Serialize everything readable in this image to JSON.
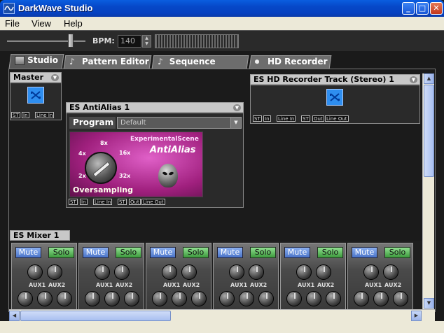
{
  "window": {
    "title": "DarkWave Studio"
  },
  "window_controls": {
    "minimize": "_",
    "maximize": "□",
    "close": "✕"
  },
  "menu": {
    "items": [
      "File",
      "View",
      "Help"
    ]
  },
  "toolbar": {
    "bpm_label": "BPM:",
    "bpm_value": "140",
    "spin_up": "▲",
    "spin_down": "▼"
  },
  "tabs": [
    {
      "label": "Studio",
      "icon": "studio-icon"
    },
    {
      "label": "Pattern Editor",
      "icon": "note-icon"
    },
    {
      "label": "Sequence Editor",
      "icon": "note-icon"
    },
    {
      "label": "HD Recorder",
      "icon": "record-icon"
    }
  ],
  "active_tab": "Studio",
  "master": {
    "title": "Master",
    "ports": [
      "ST",
      "In",
      "Line In"
    ],
    "dd": "▼"
  },
  "hd_track": {
    "title": "ES HD Recorder Track (Stereo) 1",
    "ports": [
      "ST",
      "In",
      "Line In",
      "ST",
      "Out",
      "Line Out"
    ],
    "dd": "▼"
  },
  "antialias": {
    "title": "ES AntiAlias 1",
    "dd": "▼",
    "program_label": "Program",
    "program_value": "Default",
    "select_arrow": "▼",
    "brand": "ExperimentalScene",
    "product": "AntiAlias",
    "knob_caption": "Oversampling",
    "knob_labels": [
      "8x",
      "16x",
      "4x",
      "2x",
      "32x"
    ],
    "ports": [
      "ST",
      "In",
      "Line In",
      "ST",
      "Out",
      "Line Out"
    ]
  },
  "mixer": {
    "title": "ES Mixer 1",
    "strips": [
      {
        "mute": "Mute",
        "solo": "Solo",
        "aux1": "AUX1",
        "aux2": "AUX2"
      },
      {
        "mute": "Mute",
        "solo": "Solo",
        "aux1": "AUX1",
        "aux2": "AUX2"
      },
      {
        "mute": "Mute",
        "solo": "Solo",
        "aux1": "AUX1",
        "aux2": "AUX2"
      },
      {
        "mute": "Mute",
        "solo": "Solo",
        "aux1": "AUX1",
        "aux2": "AUX2"
      },
      {
        "mute": "Mute",
        "solo": "Solo",
        "aux1": "AUX1",
        "aux2": "AUX2"
      },
      {
        "mute": "Mute",
        "solo": "Solo",
        "aux1": "AUX1",
        "aux2": "AUX2"
      }
    ]
  },
  "scroll": {
    "up": "▲",
    "down": "▼",
    "left": "◀",
    "right": "▶"
  },
  "colors": {
    "titlebar": "#0648c8",
    "mute": "#4a74c8",
    "solo": "#3c9a3c",
    "antialias_bg": "#a0207e"
  }
}
